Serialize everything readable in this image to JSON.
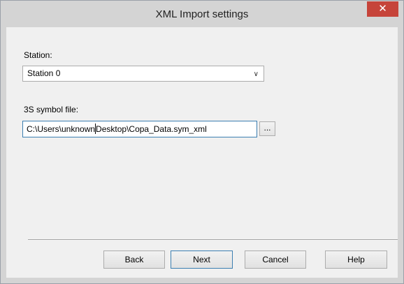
{
  "window": {
    "title": "XML Import settings",
    "close_glyph": "✕"
  },
  "station": {
    "label": "Station:",
    "selected": "Station 0",
    "chevron_glyph": "∨"
  },
  "symbol_file": {
    "label": "3S symbol file:",
    "value_before_caret": "C:\\Users\\unknown",
    "value_after_caret": "Desktop\\Copa_Data.sym_xml",
    "browse_label": "..."
  },
  "buttons": {
    "back": "Back",
    "next": "Next",
    "cancel": "Cancel",
    "help": "Help"
  },
  "colors": {
    "close_button": "#c6443a",
    "focus_border": "#3c7fb1"
  }
}
